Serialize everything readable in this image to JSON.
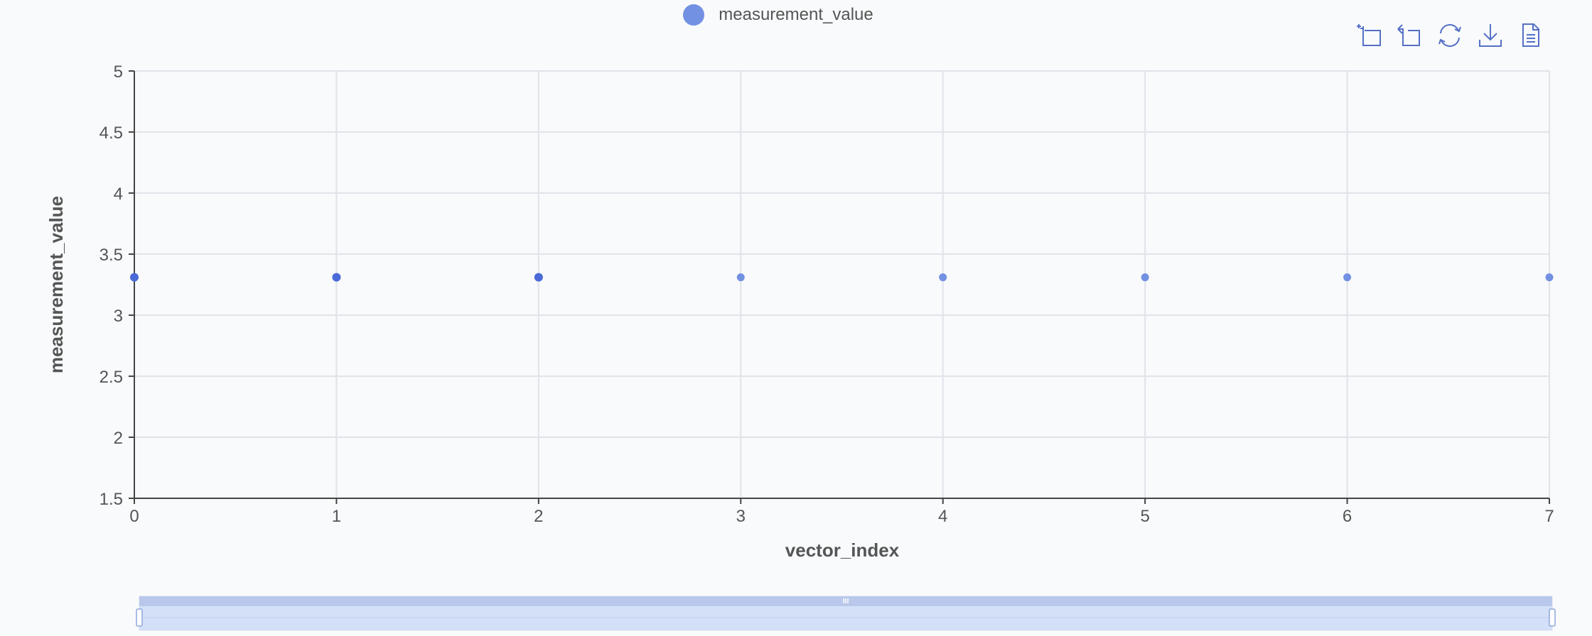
{
  "legend": {
    "label": "measurement_value",
    "color": "#7391e3"
  },
  "toolbox": {
    "tools": [
      "zoom-icon",
      "zoom-reset-icon",
      "restore-icon",
      "download-icon",
      "data-view-icon"
    ],
    "icon_color": "#5470c6"
  },
  "chart_data": {
    "type": "scatter",
    "title": "",
    "xlabel": "vector_index",
    "ylabel": "measurement_value",
    "xlim": [
      0,
      7
    ],
    "ylim": [
      1.5,
      5
    ],
    "x_ticks": [
      "0",
      "1",
      "2",
      "3",
      "4",
      "5",
      "6",
      "7"
    ],
    "y_ticks": [
      "1.5",
      "2",
      "2.5",
      "3",
      "3.5",
      "4",
      "4.5",
      "5"
    ],
    "grid": true,
    "legend_position": "top-center",
    "series": [
      {
        "name": "measurement_value",
        "color": "#7391e3",
        "x": [
          0,
          1,
          2,
          3,
          4,
          5,
          6,
          7
        ],
        "y": [
          3.31,
          3.31,
          3.31,
          3.31,
          3.31,
          3.31,
          3.31,
          3.31
        ]
      }
    ]
  },
  "data_zoom": {
    "start_percent": 0,
    "end_percent": 100
  }
}
